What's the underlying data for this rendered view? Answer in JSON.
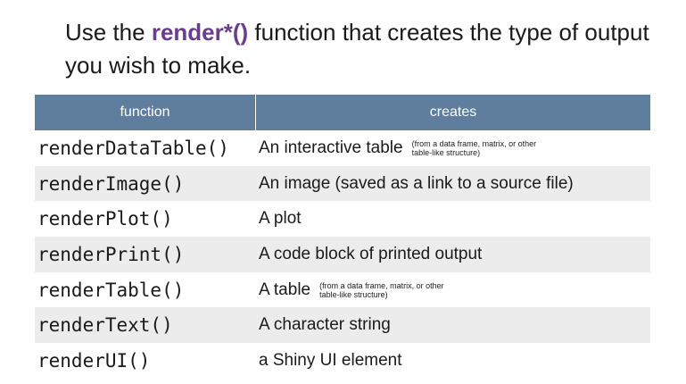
{
  "heading": {
    "prefix": "Use the ",
    "accent": "render*()",
    "suffix": " function that creates the type of output you wish to make."
  },
  "table": {
    "headers": [
      "function",
      "creates"
    ],
    "rows": [
      {
        "fn": "renderDataTable()",
        "desc": "An interactive table",
        "note": "(from a data frame, matrix, or other table-like structure)"
      },
      {
        "fn": "renderImage()",
        "desc": "An image (saved as a link to a source file)"
      },
      {
        "fn": "renderPlot()",
        "desc": "A plot"
      },
      {
        "fn": "renderPrint()",
        "desc": "A code block of printed output"
      },
      {
        "fn": "renderTable()",
        "desc": "A table",
        "note": "(from a data frame, matrix, or other table-like structure)"
      },
      {
        "fn": "renderText()",
        "desc": "A character string"
      },
      {
        "fn": "renderUI()",
        "desc": "a Shiny UI element"
      }
    ]
  },
  "colors": {
    "accent": "#6a3d8e",
    "header_bg": "#5f7d9c",
    "alt_row_bg": "#ececec"
  }
}
